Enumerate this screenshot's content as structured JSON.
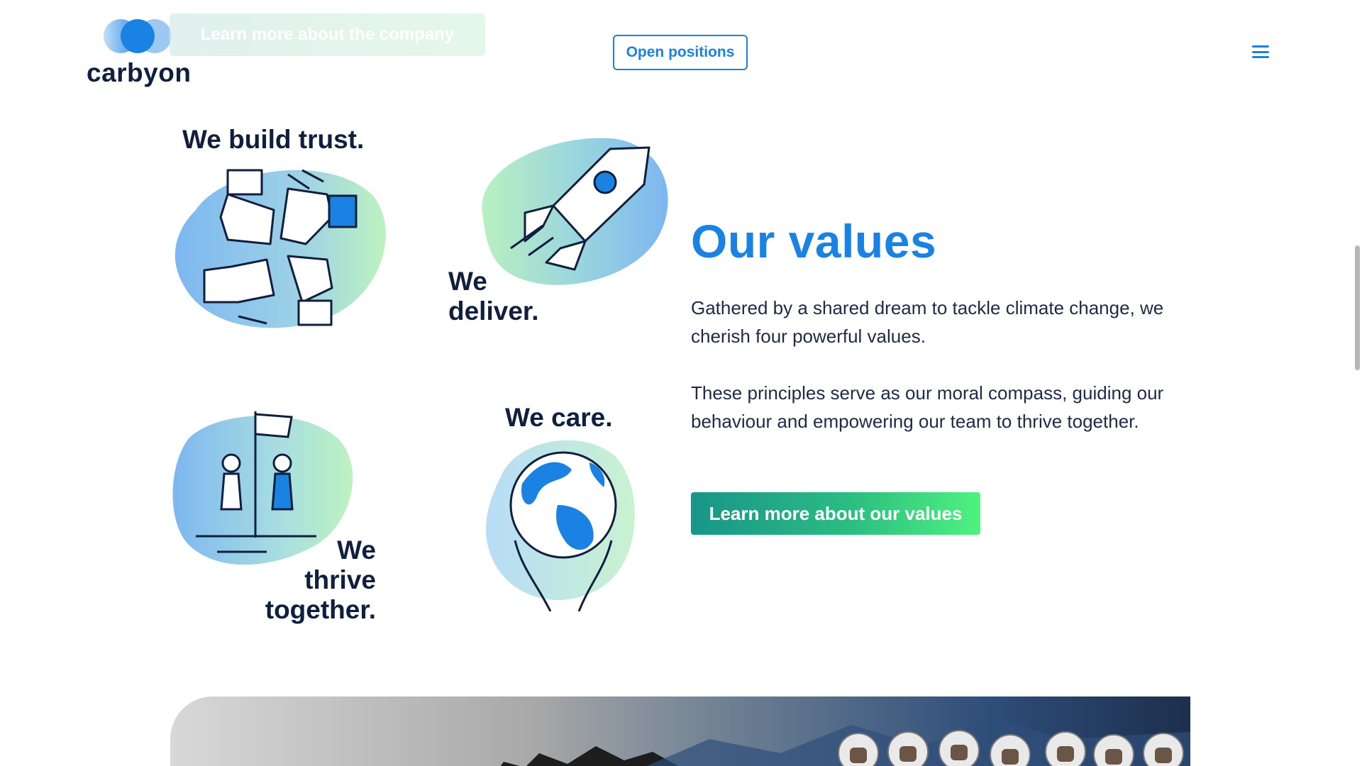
{
  "header": {
    "brand": "carbyon",
    "ghost_banner_label": "Learn more about the company",
    "open_positions_label": "Open positions",
    "menu_icon": "hamburger-icon"
  },
  "values_grid": [
    {
      "label": "We build trust.",
      "icon": "hands-circle-icon"
    },
    {
      "label": "We deliver.",
      "icon": "rocket-icon"
    },
    {
      "label": "We thrive together.",
      "icon": "people-flag-icon"
    },
    {
      "label": "We care.",
      "icon": "globe-hands-icon"
    }
  ],
  "value_labels": {
    "trust": "We build trust.",
    "deliver_line1": "We",
    "deliver_line2": "deliver.",
    "thrive_line1": "We",
    "thrive_line2": "thrive",
    "thrive_line3": "together.",
    "care": "We care."
  },
  "section": {
    "title": "Our values",
    "paragraph1": "Gathered by a shared dream to tackle climate change, we cherish four powerful values.",
    "paragraph2": "These principles serve as our moral compass, guiding our behaviour and empowering our team to thrive together.",
    "cta_label": "Learn more about our values"
  },
  "colors": {
    "brand_blue": "#1a82e2",
    "navy_text": "#0f1f3d",
    "cta_gradient_start": "#17958a",
    "cta_gradient_end": "#4ef27f",
    "blob_blue": "#7db7f0",
    "blob_green": "#b8f0c0"
  }
}
